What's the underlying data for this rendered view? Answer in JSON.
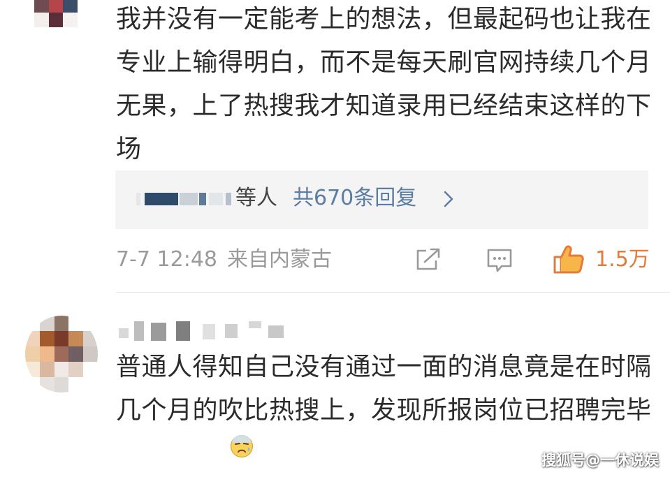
{
  "comment_1": {
    "text": "我并没有一定能考上的想法，但最起码也让我在专业上输得明白，而不是每天刷官网持续几个月无果，上了热搜我才知道录用已经结束这样的下场",
    "reply_suffix": "等人",
    "reply_count": "共670条回复",
    "timestamp": "7-7 12:48",
    "location": "来自内蒙古",
    "like_count": "1.5万",
    "avatar_colors": [
      "#ffffff",
      "#f7f4f2",
      "#e9dbd6",
      "#fbf7f5",
      "#ffffff",
      "#f4eeec",
      "#5c3b3f",
      "#9c6a72",
      "#7e6670",
      "#ffffff",
      "#ffffff",
      "#6e4c52",
      "#b4454b",
      "#3b4d68",
      "#ffffff",
      "#ffffff",
      "#f4eeec",
      "#5a2f3a",
      "#f6f1f0",
      "#ffffff",
      "#ffffff",
      "#ffffff",
      "#ffffff",
      "#ffffff",
      "#ffffff"
    ]
  },
  "comment_2": {
    "text": "普通人得知自己没有通过一面的消息竟是在时隔几个月的吹比热搜上，发现所报岗位已招聘完毕",
    "emoji": "sweat-face-emoji",
    "avatar_colors": [
      "#ffffff",
      "#d9d4cf",
      "#8b7466",
      "#ffffff",
      "#ffffff",
      "#f1d3bd",
      "#a35a2c",
      "#7a3a2a",
      "#c58a57",
      "#d8d0cb",
      "#efcfa7",
      "#f0b98c",
      "#9e6b5a",
      "#6f5f63",
      "#cfc8c5",
      "#f6e9da",
      "#d9b8a0",
      "#f0e9e5",
      "#e3d0c4",
      "#ffffff",
      "#ffffff",
      "#e6e2e0",
      "#dedad8",
      "#ffffff",
      "#ffffff"
    ]
  },
  "watermark": "搜狐号@一休说娱",
  "colors": {
    "accent": "#5b7ca3",
    "like": "#e27b3b",
    "meta": "#9a9a9a",
    "reply_bg": "#f4f4f4"
  }
}
